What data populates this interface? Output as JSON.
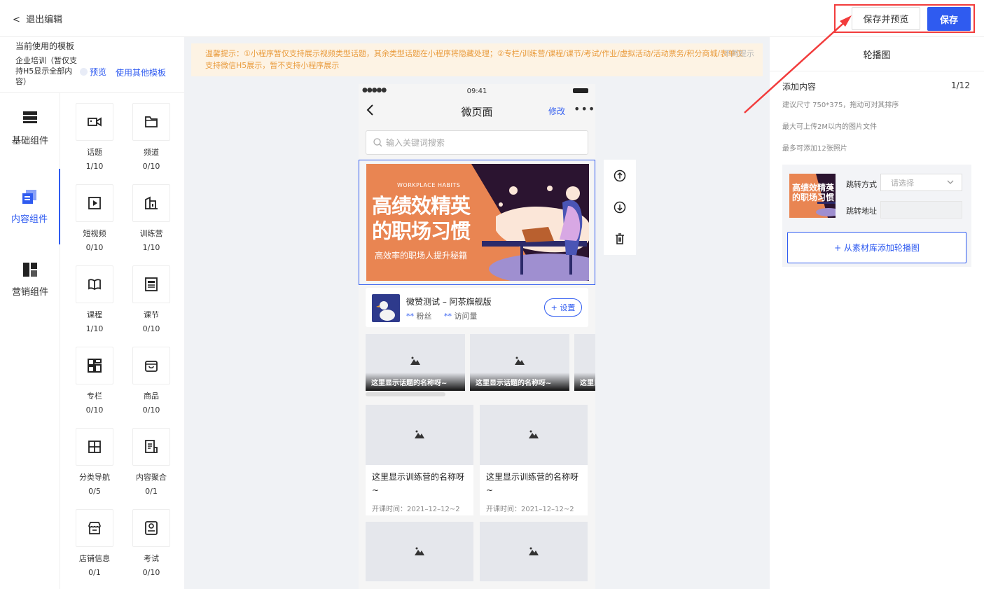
{
  "topbar": {
    "back_label": "退出编辑",
    "save_preview_label": "保存并预览",
    "save_label": "保存"
  },
  "template": {
    "title": "当前使用的模板",
    "name": "企业培训（暂仅支持H5显示全部内容）",
    "preview_label": "预览",
    "other_label": "使用其他模板"
  },
  "categories": [
    {
      "label": "基础组件",
      "icon": "layout-rows-icon"
    },
    {
      "label": "内容组件",
      "icon": "content-cards-icon"
    },
    {
      "label": "营销组件",
      "icon": "marketing-grid-icon"
    }
  ],
  "components": [
    {
      "name": "话题",
      "count": "1/10",
      "icon": "video-camera-icon"
    },
    {
      "name": "频道",
      "count": "0/10",
      "icon": "folder-icon"
    },
    {
      "name": "短视频",
      "count": "0/10",
      "icon": "play-square-icon"
    },
    {
      "name": "训练营",
      "count": "1/10",
      "icon": "building-icon"
    },
    {
      "name": "课程",
      "count": "1/10",
      "icon": "book-open-icon"
    },
    {
      "name": "课节",
      "count": "0/10",
      "icon": "document-icon"
    },
    {
      "name": "专栏",
      "count": "0/10",
      "icon": "grid-icon"
    },
    {
      "name": "商品",
      "count": "0/10",
      "icon": "bag-icon"
    },
    {
      "name": "分类导航",
      "count": "0/5",
      "icon": "table-icon"
    },
    {
      "name": "内容聚合",
      "count": "0/1",
      "icon": "list-doc-icon"
    },
    {
      "name": "店铺信息",
      "count": "0/1",
      "icon": "store-icon"
    },
    {
      "name": "考试",
      "count": "0/10",
      "icon": "exam-icon"
    }
  ],
  "tip": {
    "text": "温馨提示：①小程序暂仅支持展示视频类型话题，其余类型话题在小程序将隐藏处理；②专栏/训练营/课程/课节/考试/作业/虚拟活动/活动票务/积分商城/表单仅支持微信H5展示，暂不支持小程序展示",
    "hide_label": "不再提示"
  },
  "phone": {
    "time": "09:41",
    "signal": "●●●●●",
    "title": "微页面",
    "edit_label": "修改",
    "more": "•••",
    "search_placeholder": "输入关键词搜索",
    "banner": {
      "tag": "WORKPLACE HABITS",
      "line1": "高绩效精英",
      "line2": "的职场习惯",
      "sub": "高效率的职场人提升秘籍"
    },
    "shop": {
      "name": "微赞测试 – 阿茶旗舰版",
      "fans_value": "**",
      "fans_label": "粉丝",
      "visits_value": "**",
      "visits_label": "访问量",
      "setup_label": "+ 设置"
    },
    "topics": [
      "这里显示话题的名称呀~",
      "这里显示话题的名称呀~",
      "这里显示话题的名称呀~"
    ],
    "camps": [
      {
        "title": "这里显示训练营的名称呀~",
        "date": "开课时间：2021–12–12~2"
      },
      {
        "title": "这里显示训练营的名称呀~",
        "date": "开课时间：2021–12–12~2"
      }
    ]
  },
  "right": {
    "title": "轮播图",
    "add_label": "添加内容",
    "count": "1/12",
    "hints": [
      "建议尺寸 750*375，拖动可对其排序",
      "最大可上传2M以内的图片文件",
      "最多可添加12张照片"
    ],
    "jump_label": "跳转方式",
    "jump_placeholder": "请选择",
    "addr_label": "跳转地址",
    "add_button": "+ 从素材库添加轮播图"
  },
  "colors": {
    "accent": "#2f5bf0",
    "highlight": "#f23c3c",
    "banner": "#e98552",
    "tip_text": "#e99b3c"
  }
}
